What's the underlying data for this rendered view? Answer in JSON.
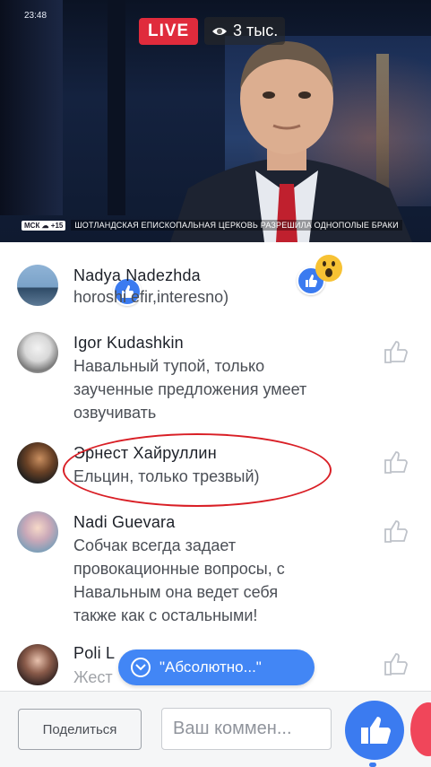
{
  "video": {
    "clock": "23:48",
    "live_label": "LIVE",
    "viewers": "3 тыс.",
    "ticker_badge": "МСК ☁ +15",
    "ticker_text": "ШОТЛАНДСКАЯ ЕПИСКОПАЛЬНАЯ ЦЕРКОВЬ РАЗРЕШИЛА ОДНОПОЛЫЕ БРАКИ"
  },
  "comments": [
    {
      "name": "Nadya Nadezhda",
      "text": "horoshi efir,interesno)"
    },
    {
      "name": "Igor  Kudashkin",
      "text": [
        "Навальный тупой, только",
        "заученные предложения умеет",
        "озвучивать"
      ]
    },
    {
      "name": "Эрнест Хайруллин",
      "text": [
        "Ельцин, только трезвый)"
      ]
    },
    {
      "name": "Nadi Guevara",
      "text": [
        "Собчак всегда задает",
        "провокационные вопросы, с",
        "Навальным она ведет себя",
        "также как с остальными!"
      ]
    },
    {
      "name": "Poli L",
      "text": "Жест"
    }
  ],
  "new_comment_pill": "\"Абсолютно...\"",
  "bottom": {
    "share_label": "Поделиться",
    "input_placeholder": "Ваш коммен..."
  },
  "colors": {
    "accent": "#3b7bf0",
    "live": "#e02b3c",
    "highlight": "#d91f26"
  }
}
